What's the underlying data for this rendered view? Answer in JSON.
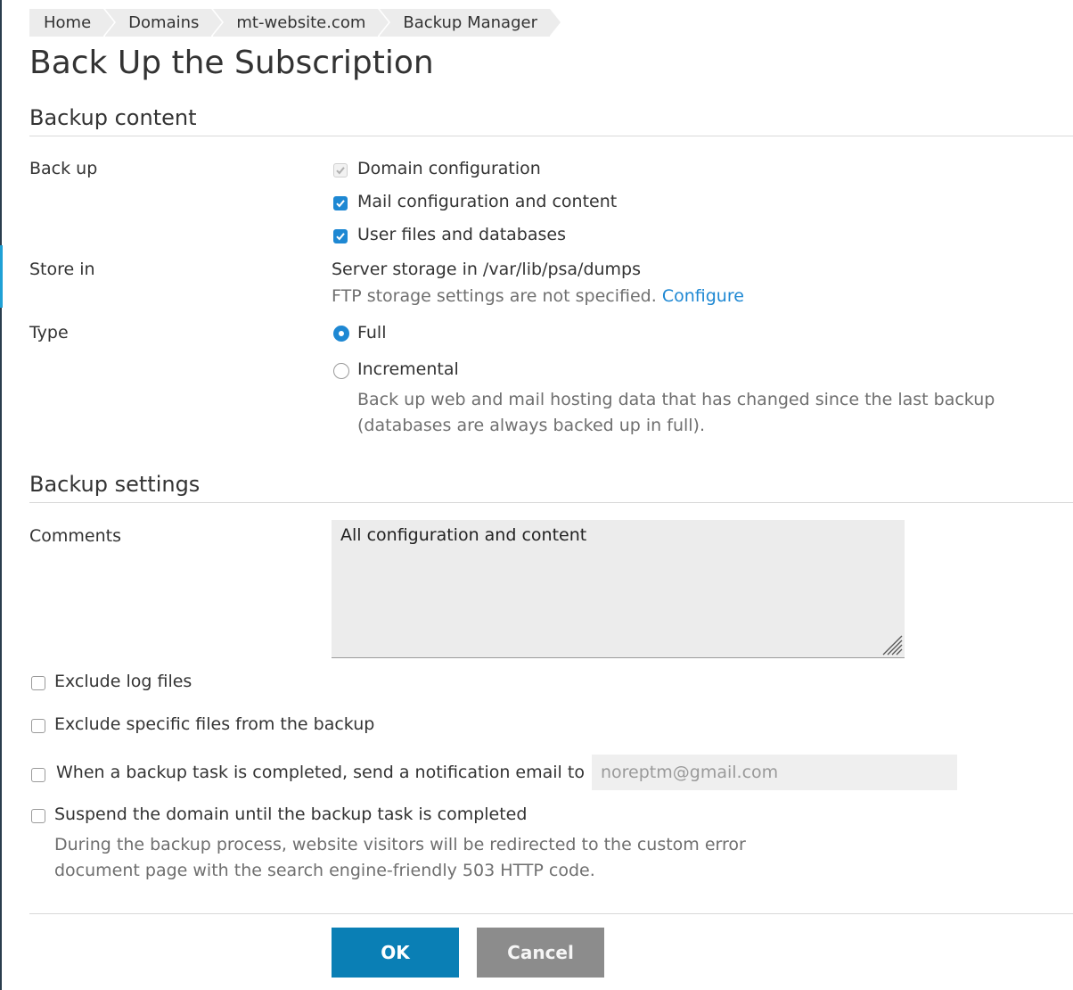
{
  "breadcrumb": [
    "Home",
    "Domains",
    "mt-website.com",
    "Backup Manager"
  ],
  "page_title": "Back Up the Subscription",
  "backup_content": {
    "title": "Backup content",
    "backup_label": "Back up",
    "options": [
      {
        "label": "Domain configuration",
        "checked": true,
        "disabled": true
      },
      {
        "label": "Mail configuration and content",
        "checked": true,
        "disabled": false
      },
      {
        "label": "User files and databases",
        "checked": true,
        "disabled": false
      }
    ],
    "store_in_label": "Store in",
    "store_in_value": "Server storage in /var/lib/psa/dumps",
    "ftp_note": "FTP storage settings are not specified.",
    "configure_link": "Configure",
    "type_label": "Type",
    "type_options": [
      {
        "label": "Full",
        "selected": true
      },
      {
        "label": "Incremental",
        "selected": false
      }
    ],
    "incremental_hint": "Back up web and mail hosting data that has changed since the last backup (databases are always backed up in full)."
  },
  "backup_settings": {
    "title": "Backup settings",
    "comments_label": "Comments",
    "comments_value": "All configuration and content",
    "exclude_logs_label": "Exclude log files",
    "exclude_specific_label": "Exclude specific files from the backup",
    "notify_label": "When a backup task is completed, send a notification email to",
    "notify_email_placeholder": "noreptm@gmail.com",
    "suspend_label": "Suspend the domain until the backup task is completed",
    "suspend_hint": "During the backup process, website visitors will be redirected to the custom error document page with the search engine-friendly 503 HTTP code."
  },
  "buttons": {
    "ok": "OK",
    "cancel": "Cancel"
  },
  "colors": {
    "accent": "#1e88d3",
    "ok_button": "#0a7fb5",
    "cancel_button": "#8c8c8c"
  }
}
